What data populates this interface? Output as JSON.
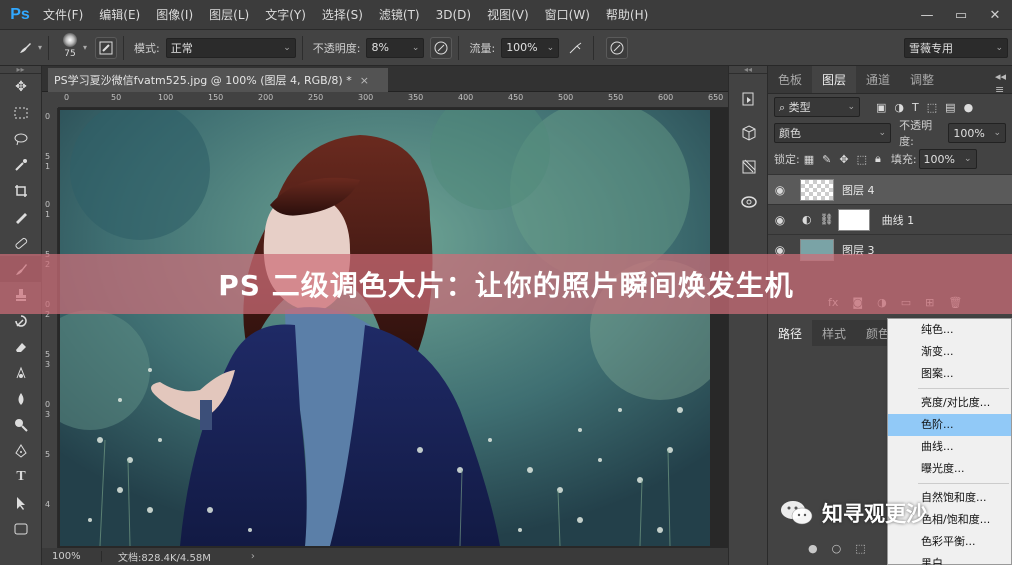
{
  "menubar": {
    "logo": "Ps",
    "items": [
      "文件(F)",
      "编辑(E)",
      "图像(I)",
      "图层(L)",
      "文字(Y)",
      "选择(S)",
      "滤镜(T)",
      "3D(D)",
      "视图(V)",
      "窗口(W)",
      "帮助(H)"
    ],
    "window_controls": [
      "—",
      "▭",
      "✕"
    ]
  },
  "options": {
    "brush_size": "75",
    "mode_label": "模式:",
    "mode_value": "正常",
    "opacity_label": "不透明度:",
    "opacity_value": "8%",
    "flow_label": "流量:",
    "flow_value": "100%",
    "workspace": "雪薇专用"
  },
  "document": {
    "tab_title": "PS学习夏沙微信fvatm525.jpg @ 100% (图层 4, RGB/8) *",
    "tab_close": "×",
    "ruler_h": [
      "0",
      "50",
      "100",
      "150",
      "200",
      "250",
      "300",
      "350",
      "400",
      "450",
      "500",
      "550",
      "600",
      "650"
    ],
    "ruler_v": [
      "0",
      "5",
      "1",
      "0",
      "1",
      "5",
      "2",
      "0",
      "2",
      "5",
      "3",
      "0",
      "3",
      "5",
      "4"
    ],
    "zoom": "100%",
    "doc_info": "文档:828.4K/4.58M",
    "status_arrow": "›"
  },
  "layers_panel": {
    "tabs": [
      "色板",
      "图层",
      "通道",
      "调整"
    ],
    "filter_kind": "类型",
    "blend_mode": "颜色",
    "opacity_label": "不透明度:",
    "opacity_value": "100%",
    "lock_label": "锁定:",
    "fill_label": "填充:",
    "fill_value": "100%",
    "layers": [
      {
        "name": "图层 4",
        "selected": true
      },
      {
        "name": "曲线 1",
        "selected": false
      },
      {
        "name": "图层 3",
        "selected": false
      }
    ],
    "bottom_fx": "fx"
  },
  "paths_panel": {
    "tabs": [
      "路径",
      "样式",
      "颜色"
    ]
  },
  "adjustment_menu": {
    "items": [
      "纯色...",
      "渐变...",
      "图案...",
      "亮度/对比度...",
      "色阶...",
      "曲线...",
      "曝光度...",
      "自然饱和度...",
      "色相/饱和度...",
      "色彩平衡...",
      "黑白..."
    ],
    "highlighted": "色阶..."
  },
  "banner": {
    "title": "PS 二级调色大片：让你的照片瞬间焕发生机"
  },
  "watermark": {
    "text": "知寻观更沙"
  },
  "colors": {
    "accent": "#31a8ff",
    "banner_bg": "#cd6e78",
    "menu_highlight": "#91c9f7"
  }
}
